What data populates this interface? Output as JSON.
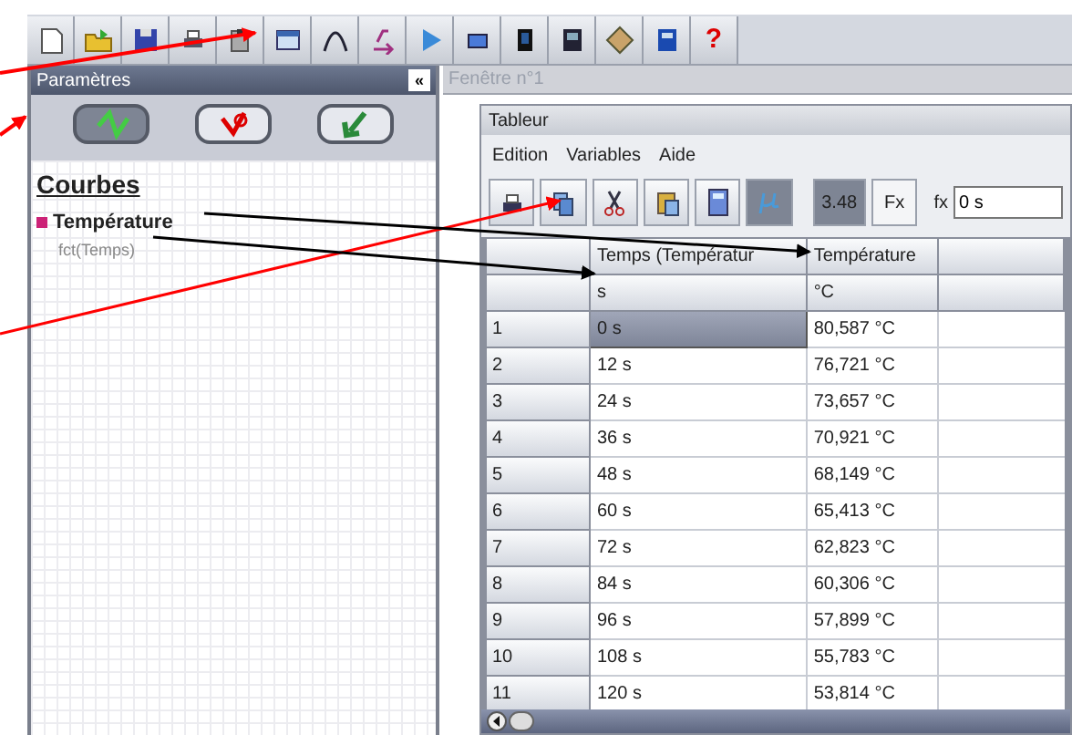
{
  "toolbar": {
    "help_label": "?"
  },
  "parameters_panel": {
    "title": "Paramètres",
    "collapse_label": "«",
    "modes": [
      {
        "selected": true
      },
      {
        "selected": false
      },
      {
        "selected": false
      }
    ],
    "section_title": "Courbes",
    "curves": [
      {
        "name": "Température",
        "color": "#cc2277",
        "function": "fct(Temps)"
      }
    ]
  },
  "window_tab": {
    "title": "Fenêtre n°1"
  },
  "tableur": {
    "title": "Tableur",
    "menu": [
      "Edition",
      "Variables",
      "Aide"
    ],
    "format_button": {
      "label": "3.48",
      "pressed": true
    },
    "units_button": {
      "pressed": true
    },
    "fx_button": {
      "label": "Fx"
    },
    "formula_bar": {
      "label": "fx",
      "value": "0 s"
    },
    "columns": [
      {
        "name": "Temps (Températur",
        "unit": "s"
      },
      {
        "name": "Température",
        "unit": "°C"
      }
    ],
    "rows": [
      {
        "number": "1",
        "time": "0 s",
        "temperature": "80,587 °C",
        "selected": true
      },
      {
        "number": "2",
        "time": "12 s",
        "temperature": "76,721 °C",
        "selected": false
      },
      {
        "number": "3",
        "time": "24 s",
        "temperature": "73,657 °C",
        "selected": false
      },
      {
        "number": "4",
        "time": "36 s",
        "temperature": "70,921 °C",
        "selected": false
      },
      {
        "number": "5",
        "time": "48 s",
        "temperature": "68,149 °C",
        "selected": false
      },
      {
        "number": "6",
        "time": "60 s",
        "temperature": "65,413 °C",
        "selected": false
      },
      {
        "number": "7",
        "time": "72 s",
        "temperature": "62,823 °C",
        "selected": false
      },
      {
        "number": "8",
        "time": "84 s",
        "temperature": "60,306 °C",
        "selected": false
      },
      {
        "number": "9",
        "time": "96 s",
        "temperature": "57,899 °C",
        "selected": false
      },
      {
        "number": "10",
        "time": "108 s",
        "temperature": "55,783 °C",
        "selected": false
      },
      {
        "number": "11",
        "time": "120 s",
        "temperature": "53,814 °C",
        "selected": false
      }
    ]
  }
}
